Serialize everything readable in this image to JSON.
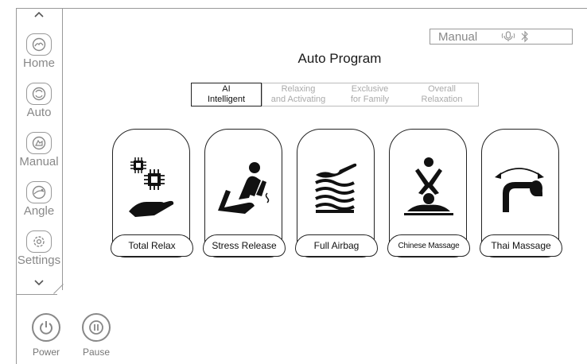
{
  "sidebar": {
    "items": [
      {
        "label": "Home",
        "icon": "home-hand-icon"
      },
      {
        "label": "Auto",
        "icon": "auto-cycle-icon"
      },
      {
        "label": "Manual",
        "icon": "manual-hand-icon"
      },
      {
        "label": "Angle",
        "icon": "angle-icon"
      },
      {
        "label": "Settings",
        "icon": "settings-gear-icon"
      }
    ],
    "scroll_up": "⌃",
    "scroll_down": "⌄"
  },
  "bottom": {
    "power_label": "Power",
    "pause_label": "Pause"
  },
  "status": {
    "mode_label": "Manual"
  },
  "header": {
    "title": "Auto Program"
  },
  "tabs": [
    {
      "line1": "AI",
      "line2": "Intelligent",
      "active": true
    },
    {
      "line1": "Relaxing",
      "line2": "and Activating",
      "active": false
    },
    {
      "line1": "Exclusive",
      "line2": "for Family",
      "active": false
    },
    {
      "line1": "Overall",
      "line2": "Relaxation",
      "active": false
    }
  ],
  "programs": [
    {
      "label": "Total Relax",
      "icon": "chip-hand-icon"
    },
    {
      "label": "Stress Release",
      "icon": "recliner-icon"
    },
    {
      "label": "Full Airbag",
      "icon": "airbag-waves-icon"
    },
    {
      "label": "Chinese Massage",
      "icon": "chinese-massage-icon"
    },
    {
      "label": "Thai Massage",
      "icon": "thai-massage-icon"
    }
  ]
}
